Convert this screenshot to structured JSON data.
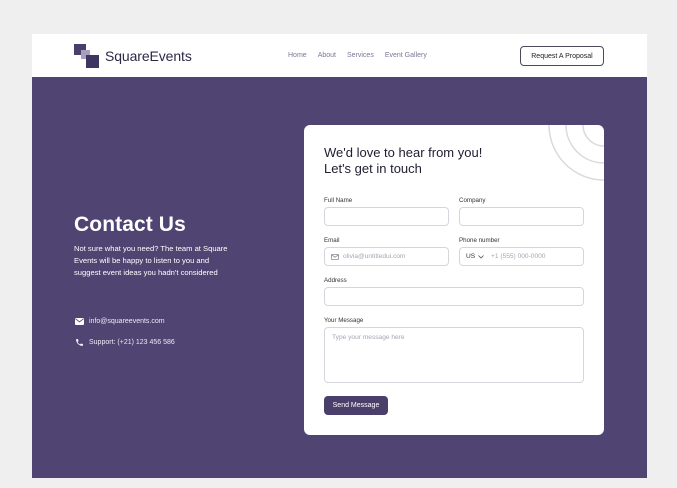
{
  "brand": {
    "name": "SquareEvents"
  },
  "nav": {
    "links": [
      "Home",
      "About",
      "Services",
      "Event Gallery"
    ],
    "cta": "Request A Proposal"
  },
  "hero": {
    "title": "Contact Us",
    "description": "Not sure what you need? The team at Square Events will be happy to listen to you and suggest event ideas you hadn't considered",
    "email": "info@squareevents.com",
    "phone": "Support: (+21) 123 456 586",
    "icons": {
      "email": "envelope-icon",
      "phone": "phone-icon"
    }
  },
  "form": {
    "heading_line1": "We'd love to hear from you!",
    "heading_line2": "Let's get in touch",
    "full_name": {
      "label": "Full Name",
      "value": ""
    },
    "company": {
      "label": "Company",
      "value": ""
    },
    "email": {
      "label": "Email",
      "placeholder": "olivia@untitledui.com"
    },
    "phone": {
      "label": "Phone number",
      "country": "US",
      "placeholder": "+1 (555) 000-0000"
    },
    "address": {
      "label": "Address",
      "value": ""
    },
    "message": {
      "label": "Your Message",
      "placeholder": "Type your message here"
    },
    "submit": "Send Message"
  },
  "colors": {
    "background": "#504472",
    "accent": "#4a3f6b",
    "page": "#efefef"
  }
}
